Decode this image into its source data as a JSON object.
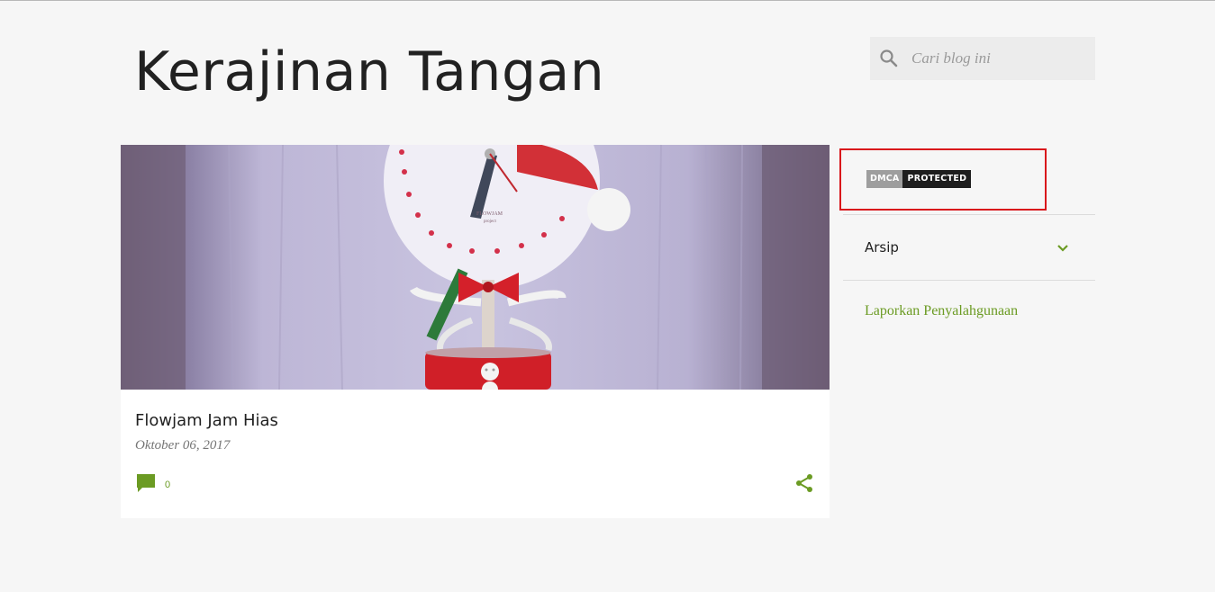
{
  "blog": {
    "title": "Kerajinan Tangan"
  },
  "search": {
    "placeholder": "Cari blog ini",
    "icon": "search-icon"
  },
  "post": {
    "title": "Flowjam Jam Hias",
    "date": "Oktober 06, 2017",
    "comment_count": "0",
    "image_caption": "FLOWJAM",
    "image_caption_sub": "project"
  },
  "sidebar": {
    "dmca": {
      "left_label": "DMCA",
      "right_label": "PROTECTED"
    },
    "archive_label": "Arsip",
    "report_label": "Laporkan Penyalahgunaan"
  },
  "colors": {
    "accent": "#6b9b23",
    "background": "#f6f6f6",
    "dmca_border": "#d9161b"
  }
}
